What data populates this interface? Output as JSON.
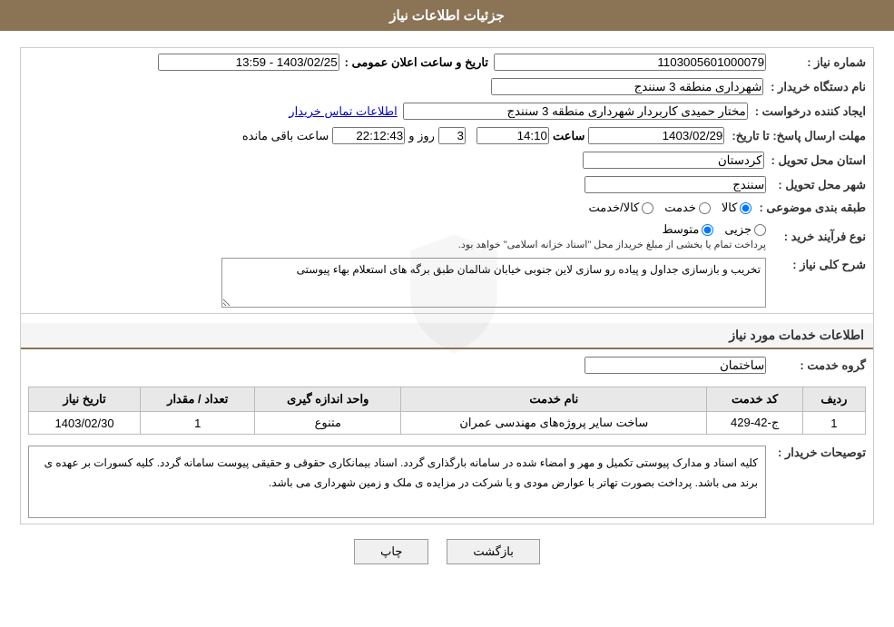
{
  "header": {
    "title": "جزئیات اطلاعات نیاز"
  },
  "fields": {
    "need_number_label": "شماره نیاز :",
    "need_number_value": "1103005601000079",
    "buyer_org_label": "نام دستگاه خریدار :",
    "buyer_org_value": "شهرداری منطقه 3 سنندج",
    "creator_label": "ایجاد کننده درخواست :",
    "creator_value": "مختار حمیدی کاربردار شهرداری منطقه 3 سنندج",
    "contact_link": "اطلاعات تماس خریدار",
    "announce_date_label": "تاریخ و ساعت اعلان عمومی :",
    "announce_date_value": "1403/02/25 - 13:59",
    "reply_deadline_label": "مهلت ارسال پاسخ: تا تاریخ:",
    "reply_date_value": "1403/02/29",
    "reply_time_label": "ساعت",
    "reply_time_value": "14:10",
    "reply_day_label": "روز و",
    "reply_days_value": "3",
    "reply_remaining_label": "ساعت باقی مانده",
    "reply_remaining_value": "22:12:43",
    "province_label": "استان محل تحویل :",
    "province_value": "کردستان",
    "city_label": "شهر محل تحویل :",
    "city_value": "سنندج",
    "category_label": "طبقه بندی موضوعی :",
    "category_options": [
      {
        "label": "کالا",
        "value": "kala"
      },
      {
        "label": "خدمت",
        "value": "khadamat"
      },
      {
        "label": "کالا/خدمت",
        "value": "kala_khadamat"
      }
    ],
    "category_selected": "kala",
    "process_label": "نوع فرآیند خرید :",
    "process_options": [
      {
        "label": "جزیی",
        "value": "jozi"
      },
      {
        "label": "متوسط",
        "value": "motavaset"
      }
    ],
    "process_selected": "motavaset",
    "process_note": "پرداخت تمام یا بخشی از مبلغ خریداز محل \"اسناد خزانه اسلامی\" خواهد بود.",
    "need_description_label": "شرح کلی نیاز :",
    "need_description_value": "تخریب و بازسازی جداول و پیاده رو سازی لاین جنوبی خیابان شالمان طبق برگه های استعلام بهاء پیوستی"
  },
  "services_section": {
    "title": "اطلاعات خدمات مورد نیاز",
    "service_group_label": "گروه خدمت :",
    "service_group_value": "ساختمان",
    "table_headers": [
      "ردیف",
      "کد خدمت",
      "نام خدمت",
      "واحد اندازه گیری",
      "تعداد / مقدار",
      "تاریخ نیاز"
    ],
    "table_rows": [
      {
        "row_num": "1",
        "service_code": "ج-42-429",
        "service_name": "ساخت سایر پروژه‌های مهندسی عمران",
        "unit": "متنوع",
        "quantity": "1",
        "need_date": "1403/02/30"
      }
    ]
  },
  "buyer_notes": {
    "label": "توصیحات خریدار :",
    "text": "کلیه اسناد و مدارک پیوستی تکمیل و مهر و امضاء شده در سامانه بارگذاری گردد. اسناد بیمانکاری حقوقی و حقیقی پیوست سامانه گردد. کلیه کسورات بر عهده ی برند می باشد. پرداخت بصورت تهاتر با عوارض مودی و یا شرکت در مزایده ی ملک و زمین شهرداری می باشد."
  },
  "buttons": {
    "print_label": "چاپ",
    "back_label": "بازگشت"
  }
}
